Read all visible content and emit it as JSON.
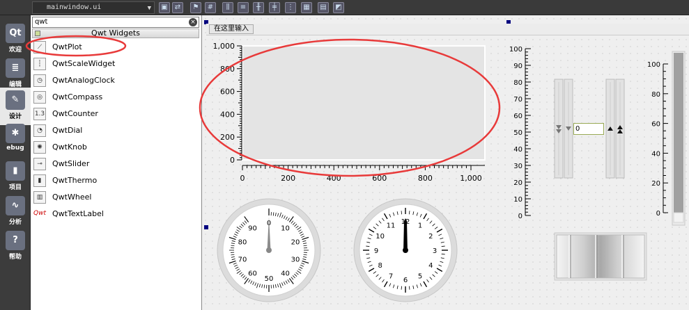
{
  "toolbar": {
    "file_name": "mainwindow.ui",
    "dropdown_icon": "triangle-down-icon",
    "buttons": [
      {
        "name": "edit-widgets-icon",
        "glyph": "▣"
      },
      {
        "name": "edit-signals-icon",
        "glyph": "⇄"
      },
      {
        "name": "edit-buddies-icon",
        "glyph": "⚑"
      },
      {
        "name": "edit-tab-order-icon",
        "glyph": "#"
      },
      {
        "name": "layout-horizontal-icon",
        "glyph": "⫼"
      },
      {
        "name": "layout-vertical-icon",
        "glyph": "≡"
      },
      {
        "name": "layout-h-splitter-icon",
        "glyph": "╫"
      },
      {
        "name": "layout-v-splitter-icon",
        "glyph": "╪"
      },
      {
        "name": "layout-form-icon",
        "glyph": "⋮"
      },
      {
        "name": "layout-grid-icon",
        "glyph": "▦"
      },
      {
        "name": "break-layout-icon",
        "glyph": "▤"
      },
      {
        "name": "adjust-size-icon",
        "glyph": "◩"
      }
    ]
  },
  "modes": [
    {
      "id": "welcome",
      "label": "欢迎",
      "glyph": "Qt",
      "active": false
    },
    {
      "id": "edit",
      "label": "编辑",
      "glyph": "≣",
      "active": false
    },
    {
      "id": "design",
      "label": "设计",
      "glyph": "✎",
      "active": true
    },
    {
      "id": "debug",
      "label": "ebug",
      "glyph": "✱",
      "active": false
    },
    {
      "id": "projects",
      "label": "项目",
      "glyph": "▮",
      "active": false
    },
    {
      "id": "analyze",
      "label": "分析",
      "glyph": "∿",
      "active": false
    },
    {
      "id": "help",
      "label": "帮助",
      "glyph": "?",
      "active": false
    }
  ],
  "widgetbox": {
    "filter_value": "qwt",
    "clear_glyph": "×",
    "category": "Qwt Widgets",
    "items": [
      {
        "name": "qwtplot",
        "label": "QwtPlot",
        "icon": "plot-icon",
        "glyph": "⟋"
      },
      {
        "name": "qwtscalewidget",
        "label": "QwtScaleWidget",
        "icon": "scale-icon",
        "glyph": "┆"
      },
      {
        "name": "qwtanalogclock",
        "label": "QwtAnalogClock",
        "icon": "clock-icon",
        "glyph": "◷"
      },
      {
        "name": "qwtcompass",
        "label": "QwtCompass",
        "icon": "compass-icon",
        "glyph": "◎"
      },
      {
        "name": "qwtcounter",
        "label": "QwtCounter",
        "icon": "counter-icon",
        "glyph": "1.3"
      },
      {
        "name": "qwtdial",
        "label": "QwtDial",
        "icon": "dial-icon",
        "glyph": "◔"
      },
      {
        "name": "qwtknob",
        "label": "QwtKnob",
        "icon": "knob-icon",
        "glyph": "✺"
      },
      {
        "name": "qwtslider",
        "label": "QwtSlider",
        "icon": "slider-icon",
        "glyph": "⊸"
      },
      {
        "name": "qwtthermo",
        "label": "QwtThermo",
        "icon": "thermo-icon",
        "glyph": "▮"
      },
      {
        "name": "qwtwheel",
        "label": "QwtWheel",
        "icon": "wheel-icon",
        "glyph": "▥"
      },
      {
        "name": "qwttextlabel",
        "label": "QwtTextLabel",
        "icon": "textlabel-icon",
        "glyph": "Qwt"
      }
    ]
  },
  "design": {
    "menu_placeholder": "在这里输入",
    "plot": {
      "y_ticks": [
        "1,000",
        "800",
        "600",
        "400",
        "200",
        "0"
      ],
      "x_ticks": [
        "0",
        "200",
        "400",
        "600",
        "800",
        "1,000"
      ],
      "xlim": [
        0,
        1000
      ],
      "ylim": [
        0,
        1000
      ]
    },
    "scale_widget": {
      "ticks": [
        "100",
        "90",
        "80",
        "70",
        "60",
        "50",
        "40",
        "30",
        "20",
        "10",
        "0"
      ]
    },
    "counter": {
      "value": "0"
    },
    "thermo": {
      "ticks": [
        "100",
        "80",
        "60",
        "40",
        "20",
        "0"
      ],
      "value": 0
    },
    "dial": {
      "labels": [
        "0",
        "10",
        "20",
        "30",
        "40",
        "50",
        "60",
        "70",
        "80",
        "90"
      ],
      "value": 0
    },
    "clock": {
      "labels": [
        "12",
        "1",
        "2",
        "3",
        "4",
        "5",
        "6",
        "7",
        "8",
        "9",
        "10",
        "11"
      ]
    }
  },
  "colors": {
    "annotation": "#e83a3a",
    "selection_handle": "#00007f"
  }
}
